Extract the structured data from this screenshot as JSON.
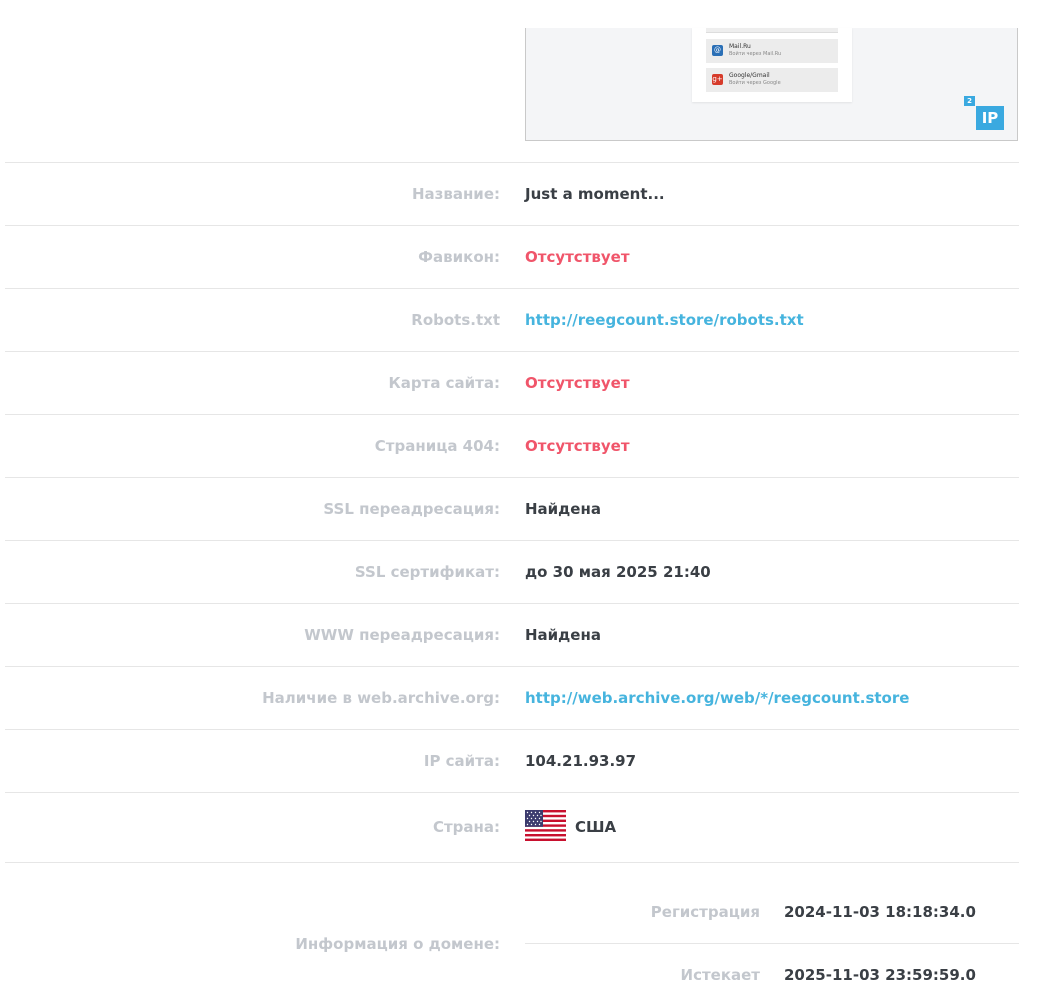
{
  "preview": {
    "options": [
      {
        "title": "Mail.Ru",
        "subtitle": "Войти через Mail.Ru",
        "icon": "mailru-icon",
        "color": "#2a6fb6"
      },
      {
        "title": "Google/Gmail",
        "subtitle": "Войти через Google",
        "icon": "google-plus-icon",
        "color": "#d63b2a"
      }
    ],
    "badge": "IP",
    "badge_sup": "2"
  },
  "rows": [
    {
      "label": "Название:",
      "value": "Just a moment...",
      "style": "normal"
    },
    {
      "label": "Фавикон:",
      "value": "Отсутствует",
      "style": "red"
    },
    {
      "label": "Robots.txt",
      "value": "http://reegcount.store/robots.txt",
      "style": "link"
    },
    {
      "label": "Карта сайта:",
      "value": "Отсутствует",
      "style": "red"
    },
    {
      "label": "Страница 404:",
      "value": "Отсутствует",
      "style": "red"
    },
    {
      "label": "SSL переадресация:",
      "value": "Найдена",
      "style": "normal"
    },
    {
      "label": "SSL сертификат:",
      "value": "до 30 мая 2025 21:40",
      "style": "normal"
    },
    {
      "label": "WWW переадресация:",
      "value": "Найдена",
      "style": "normal"
    },
    {
      "label": "Наличие в web.archive.org:",
      "value": "http://web.archive.org/web/*/reegcount.store",
      "style": "link"
    },
    {
      "label": "IP сайта:",
      "value": "104.21.93.97",
      "style": "normal"
    }
  ],
  "country": {
    "label": "Страна:",
    "value": "США",
    "flag": "us-flag-icon"
  },
  "domain": {
    "label": "Информация о домене:",
    "registration_label": "Регистрация",
    "registration_value": "2024-11-03 18:18:34.0",
    "expires_label": "Истекает",
    "expires_value": "2025-11-03 23:59:59.0"
  },
  "colors": {
    "label": "#c3c7cd",
    "value": "#3a3f45",
    "red": "#f0556a",
    "link": "#46b4de"
  }
}
